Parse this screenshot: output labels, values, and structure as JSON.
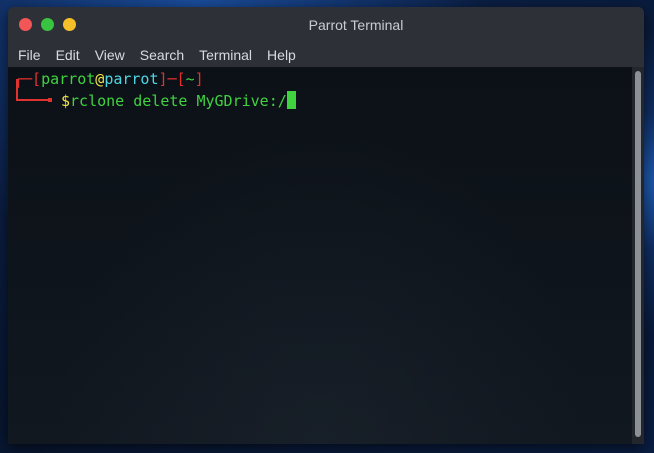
{
  "window": {
    "title": "Parrot Terminal"
  },
  "menu": {
    "items": [
      "File",
      "Edit",
      "View",
      "Search",
      "Terminal",
      "Help"
    ]
  },
  "prompt": {
    "open_bracket": "┌─[",
    "user": "parrot",
    "at": "@",
    "host": "parrot",
    "sep": "]─[",
    "path": "~",
    "close_bracket": "]",
    "dollar": "$",
    "command": "rclone delete MyGDrive:/"
  },
  "colors": {
    "prompt_bracket": "#e0322f",
    "user": "#3fd33f",
    "at": "#f1e64b",
    "host": "#4fd6e3",
    "command": "#3fd33f",
    "close": "#f25656",
    "maximize": "#38c440",
    "minimize": "#f5bf2a"
  }
}
